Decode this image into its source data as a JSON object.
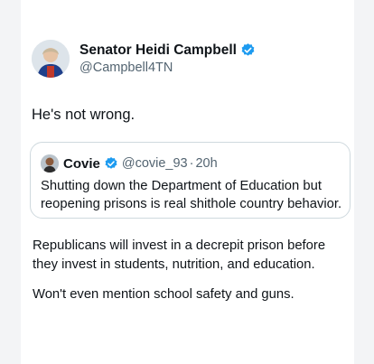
{
  "tweet": {
    "author_name": "Senator Heidi Campbell",
    "handle": "@Campbell4TN",
    "text": "He's not wrong.",
    "verified_color": "#1d9bf0"
  },
  "quoted": {
    "author_name": "Covie",
    "handle": "@covie_93",
    "separator": "·",
    "time": "20h",
    "text": "Shutting down the Department of Education but reopening prisons is real shithole country behavior."
  },
  "continuation": {
    "paragraph1": "Republicans will invest in a decrepit prison before they invest in students, nutrition, and education.",
    "paragraph2": "Won't even mention school safety and guns."
  }
}
